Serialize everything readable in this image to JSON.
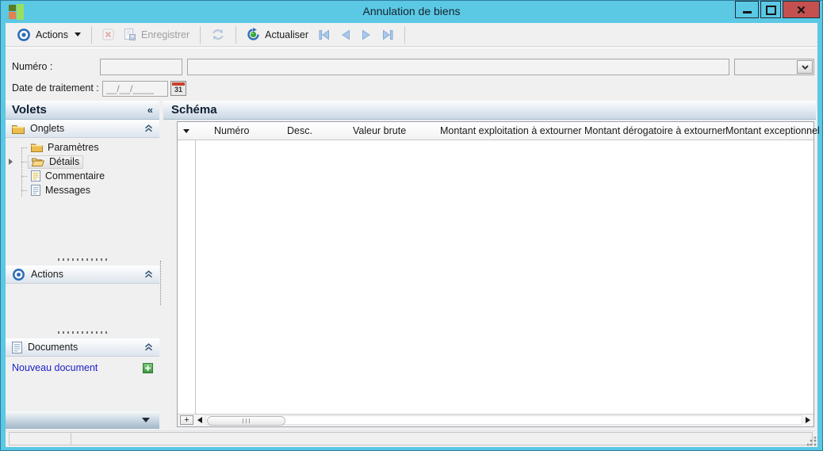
{
  "window": {
    "title": "Annulation de biens"
  },
  "toolbar": {
    "actions": "Actions",
    "save": "Enregistrer",
    "refresh": "Actualiser"
  },
  "form": {
    "numero": {
      "label": "Numéro :",
      "value": "",
      "description": ""
    },
    "combo": {
      "value": ""
    },
    "date": {
      "label": "Date de traitement :",
      "placeholder": "__/__/____",
      "calendar_day": "31"
    }
  },
  "sidebar": {
    "title": "Volets",
    "collapse_glyph": "«",
    "groups": {
      "onglets": {
        "label": "Onglets",
        "items": [
          {
            "label": "Paramètres"
          },
          {
            "label": "Détails",
            "selected": true
          },
          {
            "label": "Commentaire"
          },
          {
            "label": "Messages"
          }
        ]
      },
      "actions": {
        "label": "Actions"
      },
      "documents": {
        "label": "Documents",
        "new_link": "Nouveau document"
      }
    }
  },
  "main": {
    "title": "Schéma",
    "table": {
      "columns": [
        "Numéro",
        "Desc.",
        "Valeur brute",
        "Montant exploitation à extourner",
        "Montant dérogatoire à extourner",
        "Montant exceptionnel"
      ],
      "rows": [],
      "add_button": "+"
    }
  },
  "statusbar": {
    "cell_left": "",
    "cell_right": ""
  },
  "colors": {
    "titlebar": "#5bc8e4",
    "close_button": "#c4504f",
    "link_blue": "#2020cc",
    "plus_green": "#4aa546",
    "disabled_text": "#9f9f9f",
    "panel_header_gradient_bottom": "#c9d7e4"
  }
}
